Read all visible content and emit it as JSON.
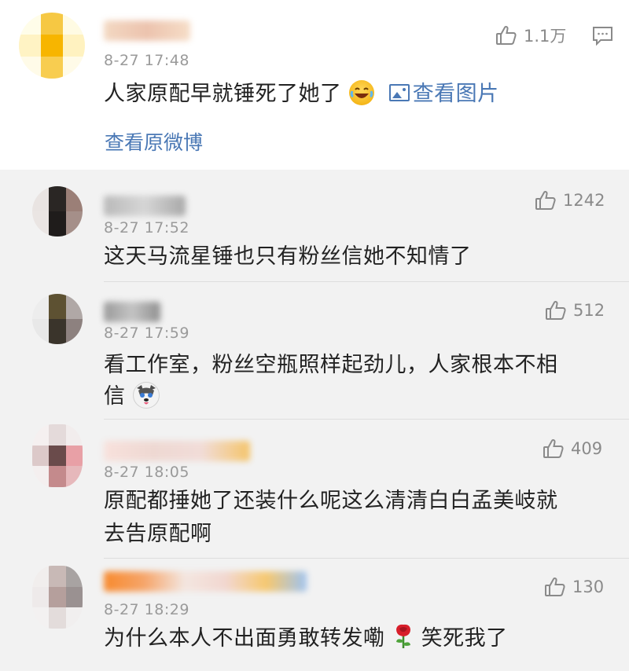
{
  "top_comment": {
    "time": "8-27 17:48",
    "text": "人家原配早就锤死了她了",
    "view_image": "查看图片",
    "likes": "1.1万",
    "view_original": "查看原微博"
  },
  "replies": [
    {
      "time": "8-27 17:52",
      "text": "这天马流星锤也只有粉丝信她不知情了",
      "likes": "1242"
    },
    {
      "time": "8-27 17:59",
      "text_line1": "看工作室，粉丝空瓶照样起劲儿，人家根本不相",
      "text_line2": "信",
      "likes": "512"
    },
    {
      "time": "8-27 18:05",
      "text_line1": "原配都捶她了还装什么呢这么清清白白孟美岐就",
      "text_line2": "去告原配啊",
      "likes": "409"
    },
    {
      "time": "8-27 18:29",
      "text_part1": "为什么本人不出面勇敢转发嘞",
      "text_part2": "笑死我了",
      "likes": "130"
    }
  ],
  "icons": {
    "like": "thumbs-up-icon",
    "comment": "comment-icon",
    "laugh": "laughing-emoji",
    "husky": "husky-emoji",
    "rose": "rose-emoji",
    "picture": "picture-icon"
  },
  "colors": {
    "link": "#4a78b5",
    "time": "#9a9a9a",
    "background": "#f2f2f2"
  }
}
